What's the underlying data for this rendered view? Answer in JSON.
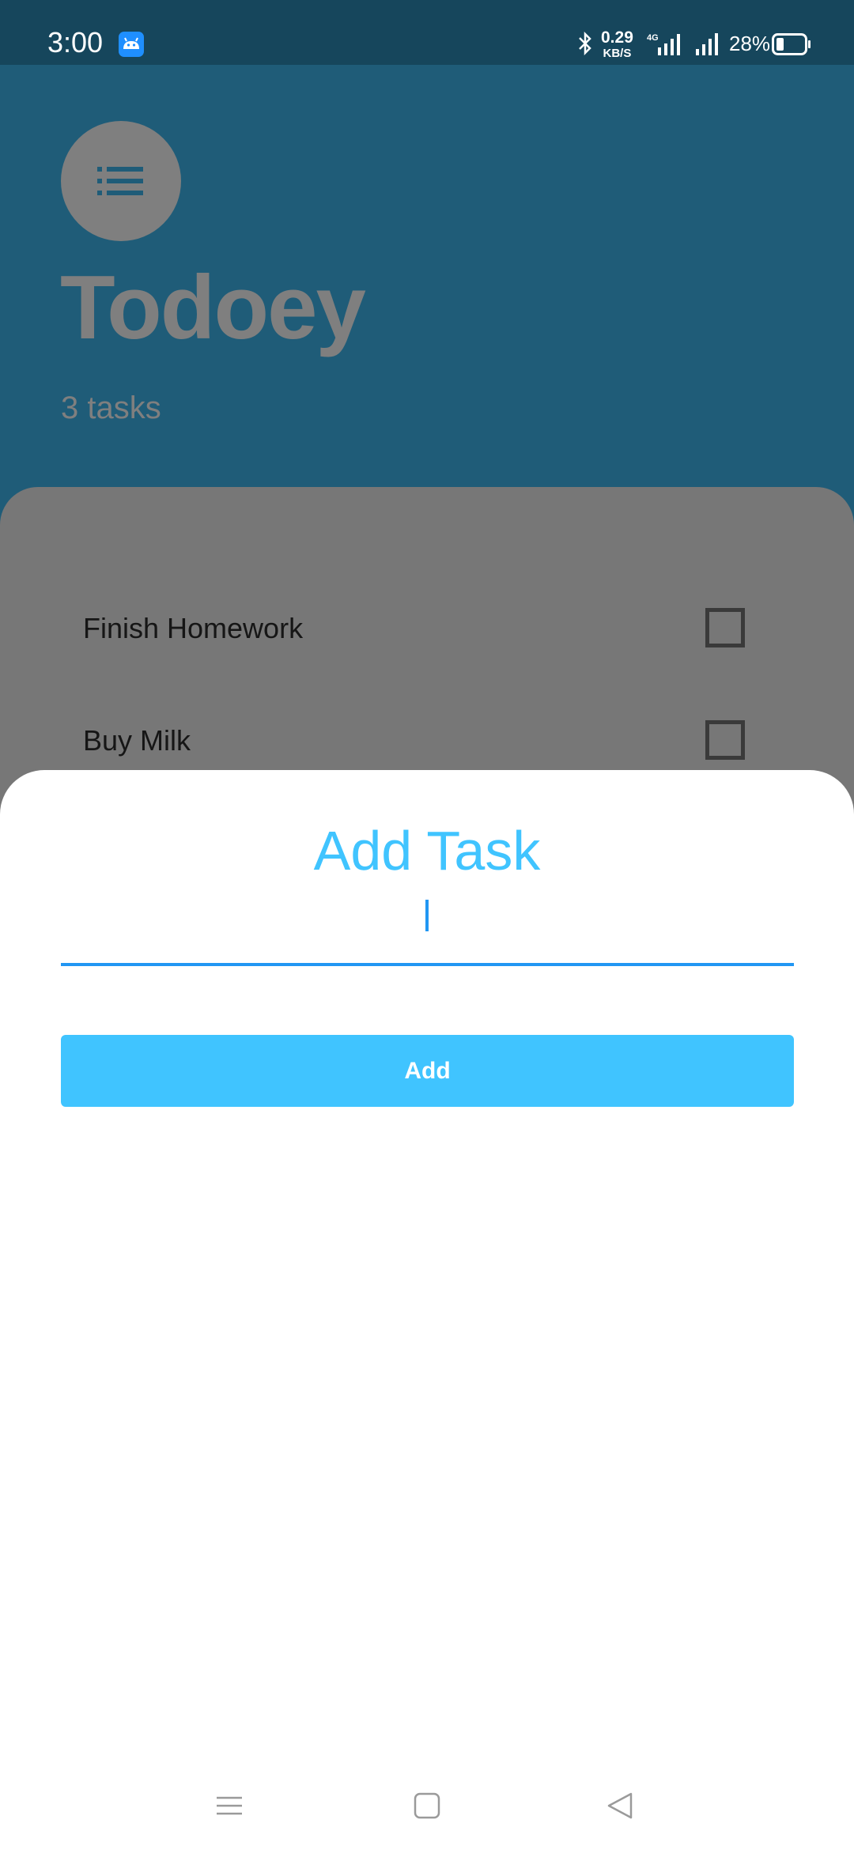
{
  "status_bar": {
    "time": "3:00",
    "net_speed_value": "0.29",
    "net_speed_unit": "KB/S",
    "network_type": "4G",
    "battery_percent": "28%",
    "icons": [
      "android-app-icon",
      "bluetooth-icon",
      "signal-icon",
      "battery-icon"
    ]
  },
  "app": {
    "title": "Todoey",
    "task_count": "3 tasks",
    "tasks": [
      {
        "label": "Finish Homework",
        "checked": false
      },
      {
        "label": "Buy Milk",
        "checked": false
      }
    ],
    "header_icon": "list-icon"
  },
  "sheet": {
    "title": "Add Task",
    "input_value": "",
    "add_label": "Add"
  },
  "colors": {
    "accent": "#40c4ff",
    "underline": "#2196f3",
    "status_bar": "#16465c",
    "app_background": "#1f5c78",
    "dim_panel": "#777777"
  },
  "nav_bar": {
    "icons": [
      "menu-icon",
      "home-icon",
      "back-icon"
    ]
  }
}
